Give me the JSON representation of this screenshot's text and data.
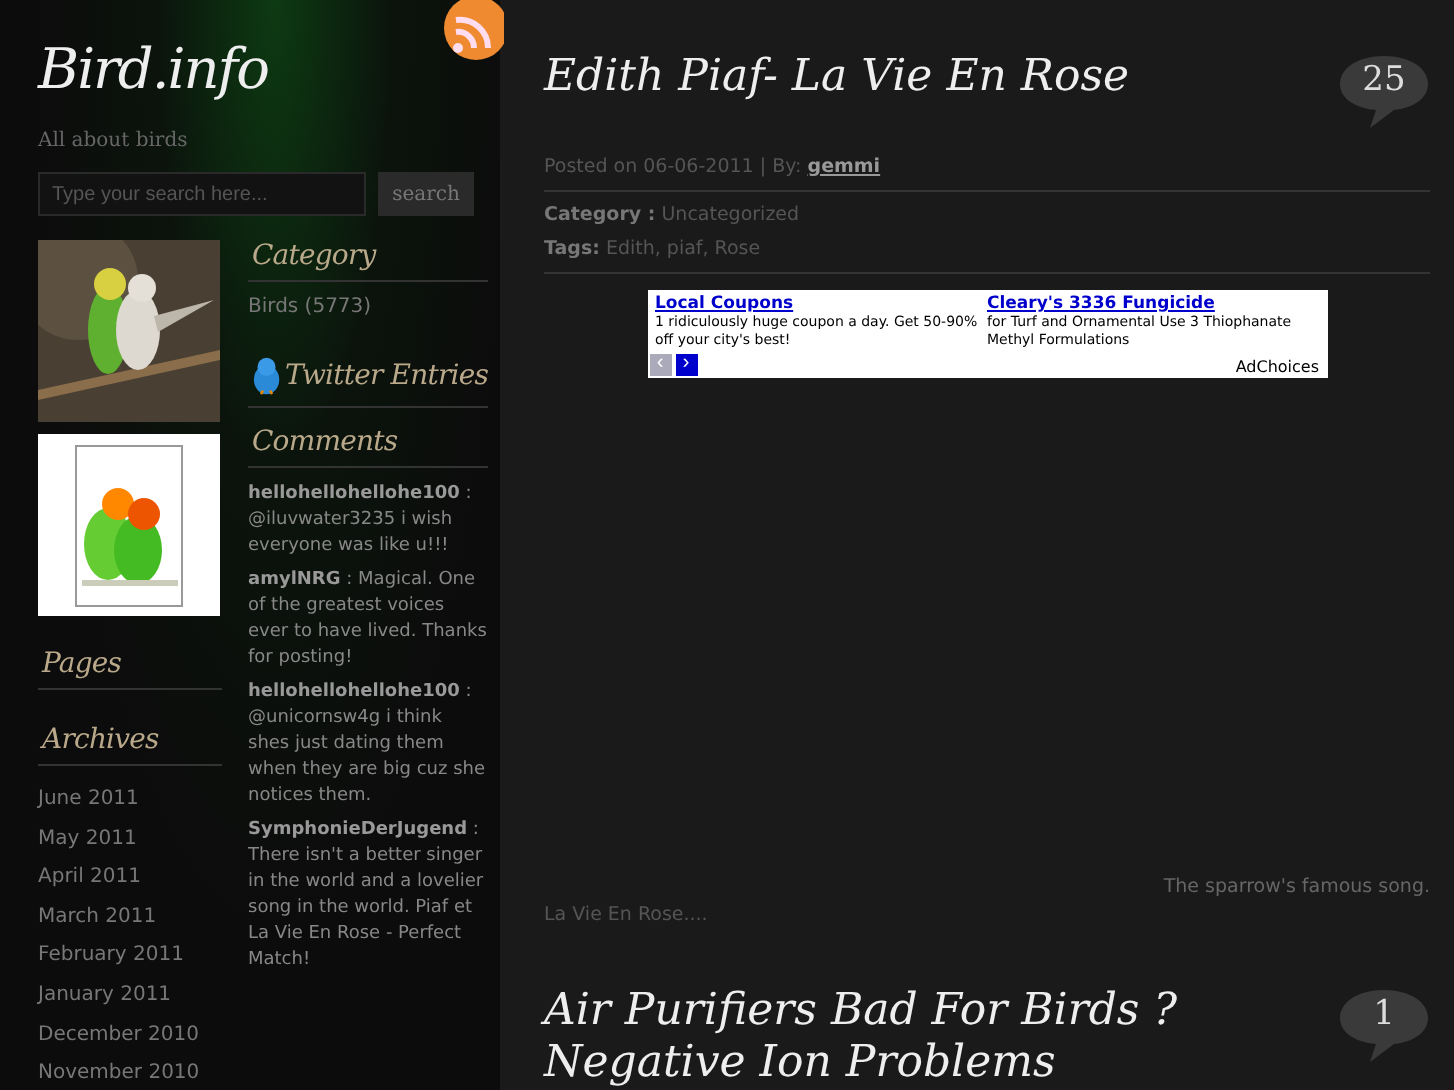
{
  "site": {
    "title": "Bird.info",
    "tagline": "All about birds"
  },
  "search": {
    "placeholder": "Type your search here...",
    "button": "search"
  },
  "category": {
    "heading": "Category",
    "items": [
      "Birds (5773)"
    ]
  },
  "twitter": {
    "heading": "Twitter Entries"
  },
  "comments": {
    "heading": "Comments",
    "items": [
      {
        "author": "hellohellohellohe100",
        "text": ": @iluvwater3235 i wish everyone was like u!!!"
      },
      {
        "author": "amylNRG",
        "text": ": Magical. One of the greatest voices ever to have lived. Thanks for posting!"
      },
      {
        "author": "hellohellohellohe100",
        "text": ": @unicornsw4g i think shes just dating them when they are big cuz she notices them."
      },
      {
        "author": "SymphonieDerJugend",
        "text": ": There isn't a better singer in the world and a lovelier song in the world. Piaf et La Vie En Rose - Perfect Match!"
      }
    ]
  },
  "pages": {
    "heading": "Pages"
  },
  "archives": {
    "heading": "Archives",
    "items": [
      "June 2011",
      "May 2011",
      "April 2011",
      "March 2011",
      "February 2011",
      "January 2011",
      "December 2010",
      "November 2010"
    ]
  },
  "posts": [
    {
      "title": "Edith Piaf- La Vie En Rose",
      "comments": "25",
      "posted": "Posted on 06-06-2011 | By:",
      "author": "gemmi",
      "category_label": "Category :",
      "category": "Uncategorized",
      "tags_label": "Tags:",
      "tags": "Edith, piaf, Rose",
      "ad": {
        "items": [
          {
            "title": "Local Coupons",
            "text": "1 ridiculously huge coupon a day. Get 50-90% off your city's best!"
          },
          {
            "title": "Cleary's 3336 Fungicide",
            "text": "for Turf and Ornamental Use 3 Thiophanate Methyl Formulations"
          }
        ],
        "choices": "AdChoices",
        "prev": "‹",
        "next": "›"
      },
      "caption": "The sparrow's famous song.",
      "excerpt": "La Vie En Rose...."
    },
    {
      "title": "Air Purifiers Bad For Birds ? Negative Ion Problems",
      "comments": "1"
    }
  ]
}
